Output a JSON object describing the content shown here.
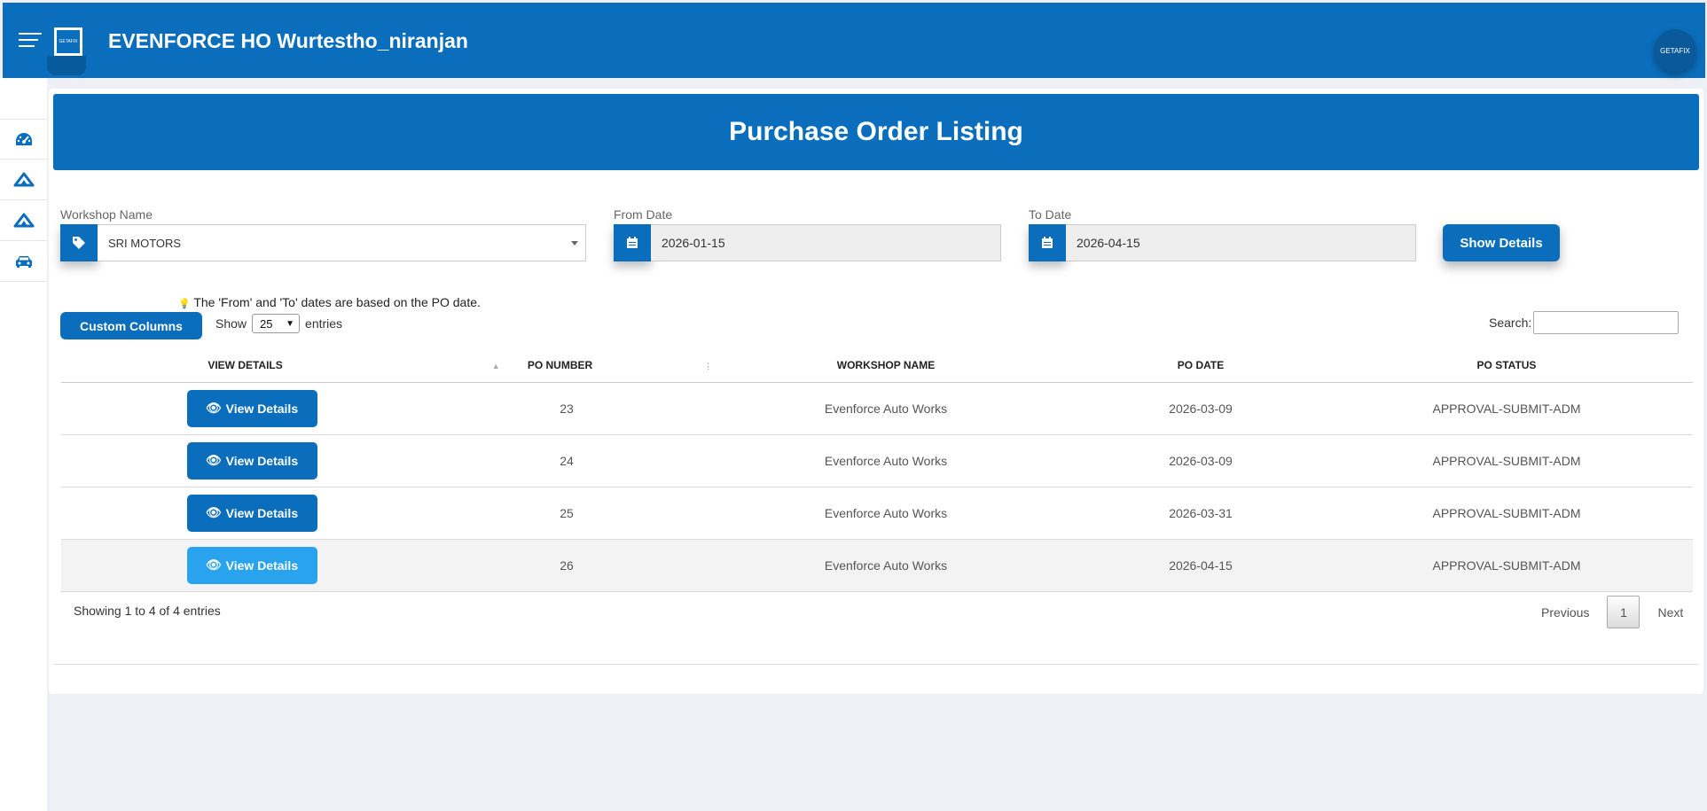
{
  "app": {
    "title": "EVENFORCE HO Wurtestho_niranjan",
    "logo_text": "GETAFIX",
    "avatar_text": "GETAFIX"
  },
  "sidebar": {
    "items": [
      {
        "icon": "speedometer-icon"
      },
      {
        "icon": "ship-icon"
      },
      {
        "icon": "ship-icon"
      },
      {
        "icon": "car-icon"
      }
    ]
  },
  "page": {
    "title": "Purchase Order Listing"
  },
  "filters": {
    "workshop_label": "Workshop Name",
    "workshop_value": "SRI MOTORS",
    "from_label": "From Date",
    "from_value": "2026-01-15",
    "to_label": "To Date",
    "to_value": "2026-04-15",
    "show_details_label": "Show Details"
  },
  "note": "The 'From' and 'To' dates are based on the PO date.",
  "controls": {
    "custom_columns_label": "Custom Columns",
    "show_label": "Show",
    "entries_value": "25",
    "entries_label": "entries",
    "search_label": "Search:"
  },
  "table": {
    "columns": [
      "VIEW DETAILS",
      "PO NUMBER",
      "WORKSHOP NAME",
      "PO DATE",
      "PO STATUS"
    ],
    "view_button_label": "View Details",
    "rows": [
      {
        "po_number": "23",
        "workshop": "Evenforce Auto Works",
        "po_date": "2026-03-09",
        "status": "APPROVAL-SUBMIT-ADM"
      },
      {
        "po_number": "24",
        "workshop": "Evenforce Auto Works",
        "po_date": "2026-03-09",
        "status": "APPROVAL-SUBMIT-ADM"
      },
      {
        "po_number": "25",
        "workshop": "Evenforce Auto Works",
        "po_date": "2026-03-31",
        "status": "APPROVAL-SUBMIT-ADM"
      },
      {
        "po_number": "26",
        "workshop": "Evenforce Auto Works",
        "po_date": "2026-04-15",
        "status": "APPROVAL-SUBMIT-ADM"
      }
    ]
  },
  "footer": {
    "info": "Showing 1 to 4 of 4 entries",
    "previous_label": "Previous",
    "page": "1",
    "next_label": "Next"
  },
  "colors": {
    "primary": "#0a6ebd",
    "hover_button": "#2aa3ef",
    "background": "#eef0f5"
  }
}
